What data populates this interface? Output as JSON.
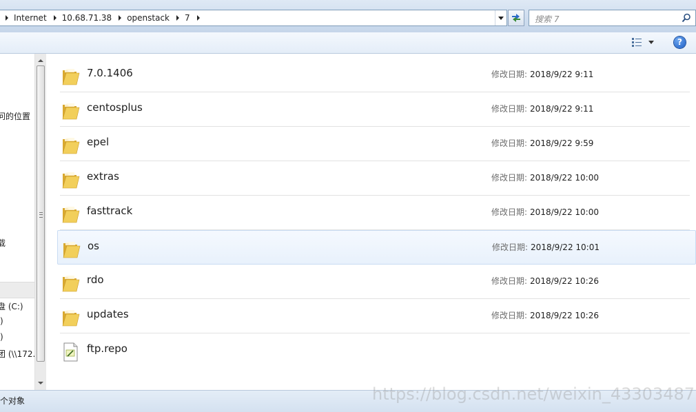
{
  "address_bar": {
    "crumbs": [
      "Internet",
      "10.68.71.38",
      "openstack",
      "7"
    ]
  },
  "search": {
    "placeholder": "搜索 7"
  },
  "toolbar": {
    "view_icon": "details-view-icon",
    "help_label": "?"
  },
  "nav": {
    "items": [
      {
        "label": "问的位置"
      },
      {
        "label": "载"
      },
      {
        "label": "盘 (C:)"
      },
      {
        "label": ":)"
      },
      {
        "label": ":)"
      },
      {
        "label": "团 (\\\\172."
      }
    ]
  },
  "files": [
    {
      "name": "7.0.1406",
      "type": "folder",
      "date_label": "修改日期:",
      "date": "2018/9/22 9:11"
    },
    {
      "name": "centosplus",
      "type": "folder",
      "date_label": "修改日期:",
      "date": "2018/9/22 9:11"
    },
    {
      "name": "epel",
      "type": "folder",
      "date_label": "修改日期:",
      "date": "2018/9/22 9:59"
    },
    {
      "name": "extras",
      "type": "folder",
      "date_label": "修改日期:",
      "date": "2018/9/22 10:00"
    },
    {
      "name": "fasttrack",
      "type": "folder",
      "date_label": "修改日期:",
      "date": "2018/9/22 10:00"
    },
    {
      "name": "os",
      "type": "folder",
      "date_label": "修改日期:",
      "date": "2018/9/22 10:01",
      "highlighted": true
    },
    {
      "name": "rdo",
      "type": "folder",
      "date_label": "修改日期:",
      "date": "2018/9/22 10:26"
    },
    {
      "name": "updates",
      "type": "folder",
      "date_label": "修改日期:",
      "date": "2018/9/22 10:26"
    },
    {
      "name": "ftp.repo",
      "type": "file",
      "date_label": "",
      "date": ""
    }
  ],
  "status": {
    "text": "个对象"
  },
  "watermark": "https://blog.csdn.net/weixin_43303487",
  "colors": {
    "folder": "#f2cf5b",
    "highlight": "#e8f1fc",
    "help": "#1c5dc4"
  }
}
